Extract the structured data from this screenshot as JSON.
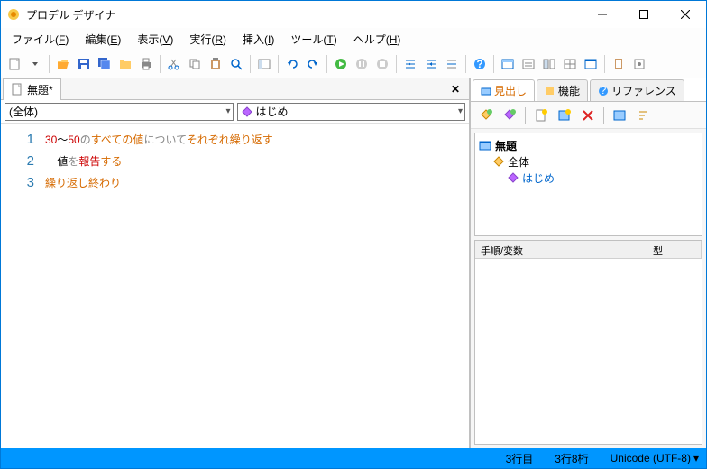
{
  "window": {
    "title": "プロデル デザイナ"
  },
  "menu": {
    "file": "ファイル(",
    "file_u": "F",
    "file_end": ")",
    "edit": "編集(",
    "edit_u": "E",
    "edit_end": ")",
    "view": "表示(",
    "view_u": "V",
    "view_end": ")",
    "run": "実行(",
    "run_u": "R",
    "run_end": ")",
    "insert": "挿入(",
    "insert_u": "I",
    "insert_end": ")",
    "tool": "ツール(",
    "tool_u": "T",
    "tool_end": ")",
    "help": "ヘルプ(",
    "help_u": "H",
    "help_end": ")"
  },
  "tabs": {
    "doc_name": "無題*"
  },
  "filter": {
    "scope": "(全体)",
    "method": "はじめ"
  },
  "code": {
    "lines": [
      {
        "n": "1",
        "segments": [
          {
            "t": "30",
            "c": "c-num"
          },
          {
            "t": "～",
            "c": "c-plain"
          },
          {
            "t": "50",
            "c": "c-num"
          },
          {
            "t": "の",
            "c": "c-part"
          },
          {
            "t": "すべての値",
            "c": "c-key"
          },
          {
            "t": "について",
            "c": "c-part"
          },
          {
            "t": "それぞれ繰り返す",
            "c": "c-key"
          }
        ]
      },
      {
        "n": "2",
        "segments": [
          {
            "t": "    ",
            "c": "c-plain"
          },
          {
            "t": "値",
            "c": "c-plain"
          },
          {
            "t": "を",
            "c": "c-part"
          },
          {
            "t": "報告",
            "c": "c-num"
          },
          {
            "t": "する",
            "c": "c-key"
          }
        ]
      },
      {
        "n": "3",
        "segments": [
          {
            "t": "繰り返し終わり",
            "c": "c-key"
          }
        ]
      }
    ]
  },
  "right": {
    "tab_outline": "見出し",
    "tab_func": "機能",
    "tab_ref": "リファレンス",
    "tree": {
      "root": "無題",
      "child1": "全体",
      "child2": "はじめ"
    },
    "prop": {
      "col1": "手順/変数",
      "col2": "型"
    }
  },
  "status": {
    "line": "3行目",
    "col": "3行8桁",
    "encoding": "Unicode (UTF-8)"
  }
}
